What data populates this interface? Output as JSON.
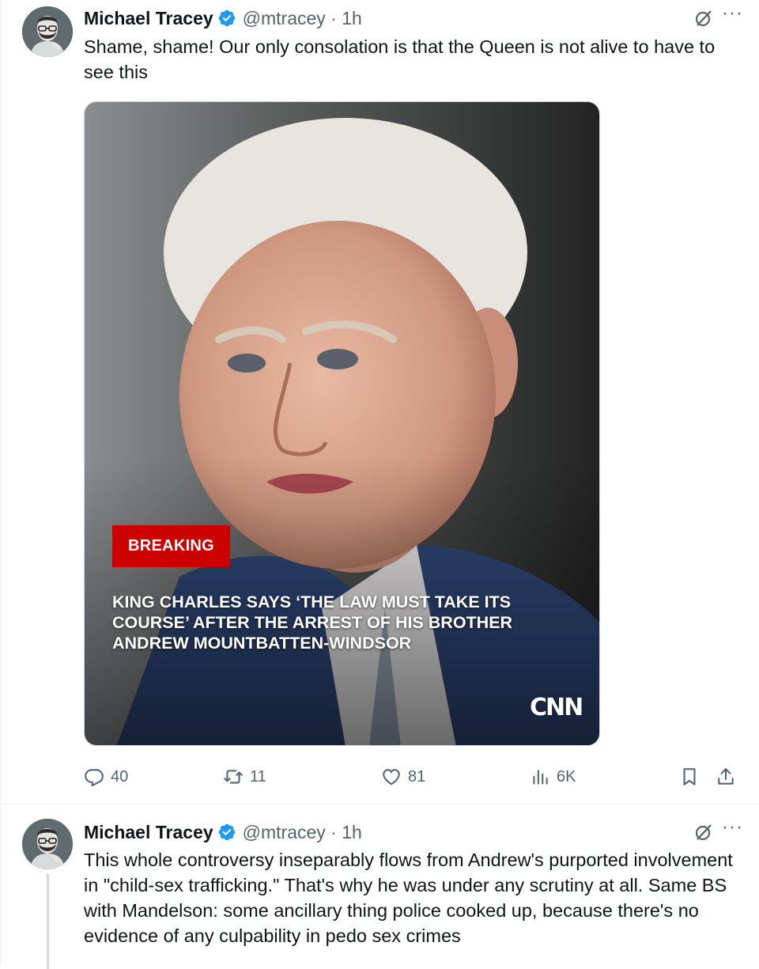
{
  "tweets": [
    {
      "author": {
        "name": "Michael Tracey",
        "handle": "@mtracey",
        "time": "1h",
        "verified": true
      },
      "meta": "@mtracey · 1h",
      "text": "Shame, shame! Our only consolation is that the Queen is not alive to have to see this",
      "media": {
        "badge": "BREAKING",
        "headline": "KING CHARLES SAYS ‘THE LAW MUST TAKE ITS COURSE’ AFTER THE ARREST OF HIS BROTHER ANDREW MOUNTBATTEN-WINDSOR",
        "logo_text": "CNN"
      },
      "stats": {
        "replies": "40",
        "reposts": "11",
        "likes": "81",
        "views": "6K"
      }
    },
    {
      "author": {
        "name": "Michael Tracey",
        "handle": "@mtracey",
        "time": "1h",
        "verified": true
      },
      "meta": "@mtracey · 1h",
      "text": "This whole controversy inseparably flows from Andrew's purported involvement in \"child-sex trafficking.\" That's why he was under any scrutiny at all. Same BS with Mandelson: some ancillary thing police cooked up, because there's no evidence of any culpability in pedo sex crimes"
    }
  ],
  "icons": {
    "verified": "verified-badge-icon",
    "grok": "grok-icon",
    "more": "more-icon",
    "reply": "reply-icon",
    "repost": "repost-icon",
    "like": "heart-icon",
    "views": "views-icon",
    "bookmark": "bookmark-icon",
    "share": "share-icon"
  },
  "colors": {
    "verified_blue": "#1d9bf0",
    "text_primary": "#0f1419",
    "text_secondary": "#536471",
    "breaking_red": "#cc0000"
  }
}
